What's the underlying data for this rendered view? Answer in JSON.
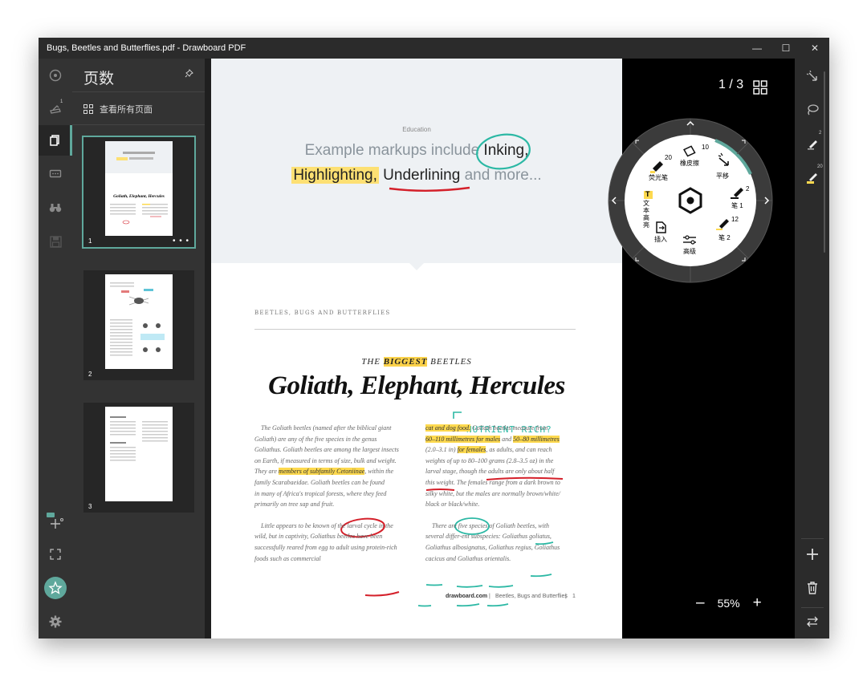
{
  "window": {
    "title": "Bugs, Beetles and Butterflies.pdf - Drawboard PDF",
    "minimize": "—",
    "maximize": "☐",
    "close": "✕"
  },
  "left_toolbar": {
    "items": [
      {
        "name": "annotations",
        "icon": "target-icon"
      },
      {
        "name": "stamp",
        "icon": "stamp-icon",
        "badge": "1"
      },
      {
        "name": "pages",
        "icon": "pages-icon",
        "active": true
      },
      {
        "name": "comments",
        "icon": "comment-icon"
      },
      {
        "name": "search",
        "icon": "binoculars-icon"
      },
      {
        "name": "save",
        "icon": "save-icon"
      }
    ],
    "bottom": [
      {
        "name": "calibrate",
        "icon": "calibrate-icon"
      },
      {
        "name": "fullscreen",
        "icon": "expand-icon"
      },
      {
        "name": "favorites",
        "icon": "star-icon"
      },
      {
        "name": "settings",
        "icon": "gear-icon"
      }
    ]
  },
  "pages_panel": {
    "title": "页数",
    "view_all": "查看所有页面",
    "thumbnails": [
      {
        "number": "1",
        "selected": true,
        "more": "• • •"
      },
      {
        "number": "2",
        "selected": false
      },
      {
        "number": "3",
        "selected": false
      }
    ]
  },
  "document": {
    "band": {
      "category": "Education",
      "line1_before": "Example markups include ",
      "line1_strong": "Inking,",
      "line2_hl": "Highlighting,",
      "line2_strong": "Underlining",
      "line2_after": " and more..."
    },
    "section_label": "BEETLES, BUGS AND BUTTERFLIES",
    "kicker_before": "THE ",
    "kicker_hl": "BIGGEST",
    "kicker_after": " BEETLES",
    "title": "Goliath, Elephant, Hercules",
    "ink_note": "NUTRIENT RICH?",
    "col1": {
      "p1": [
        "The Goliath beetles (named after the biblical giant",
        "Goliath) are any of the five species in the genus",
        "Goliathus. Goliath beetles are among the largest insects",
        "on Earth, if measured in terms of size, bulk and weight.",
        "They are ",
        "members of subfamily Cetoniinae",
        ", within the",
        "family Scarabaeidae. Goliath beetles can be found",
        "in many of Africa's tropical forests, where they feed",
        "primarily on tree sap and fruit."
      ],
      "p2": [
        "Little appears to be known of the larval cycle in the",
        "wild, but in captivity, Goliathus beetles have been",
        "successfully reared from egg to adult using protein-rich",
        "foods such as commercial"
      ]
    },
    "col2": {
      "p1": [
        "cat and dog food.",
        " Goliath beetles measure from",
        "60–110 millimetres for males",
        " and ",
        "50–80 millimetres",
        "(2.0–3.1 in) ",
        "for females",
        ", as adults, and can reach",
        "weights of up to 80–100 grams (2.8–3.5 oz) in the",
        "larval stage, though the adults are only about half",
        "this weight. The females range from a dark brown to",
        "silky white, but the males are normally brown/white/",
        "black or black/white."
      ],
      "p2": [
        "There are five species of Goliath beetles, with",
        "several differ-ent subspecies: Goliathus goliatus,",
        "Goliathus albosignatus, Goliathus regius, Goliathus",
        "cacicus and Goliathus orientalis."
      ]
    },
    "footer_site": "drawboard.com",
    "footer_sep": "|",
    "footer_title": "Beetles, Bugs and Butterflies",
    "footer_page": "1"
  },
  "viewer": {
    "page_indicator": "1 / 3",
    "zoom_minus": "–",
    "zoom_level": "55%",
    "zoom_plus": "+"
  },
  "radial_menu": {
    "highlighter": {
      "label": "荧光笔",
      "size": "20"
    },
    "eraser": {
      "label": "橡皮擦",
      "size": "10"
    },
    "pan": {
      "label": "平移"
    },
    "pen1": {
      "label": "笔 1",
      "size": "2"
    },
    "pen2": {
      "label": "笔 2",
      "size": "12"
    },
    "advanced": {
      "label": "高级"
    },
    "insert": {
      "label": "插入"
    },
    "text_hl": {
      "label": "文本高亮",
      "glyph": "T"
    },
    "accent": "#5fa89c"
  },
  "right_toolbar": {
    "items": [
      {
        "name": "pan",
        "icon": "pan-icon"
      },
      {
        "name": "lasso",
        "icon": "lasso-icon"
      },
      {
        "name": "pen",
        "icon": "pen-icon",
        "badge": "2"
      },
      {
        "name": "highlighter",
        "icon": "highlighter-icon",
        "badge": "20"
      }
    ],
    "bottom": [
      {
        "name": "add",
        "icon": "plus-icon"
      },
      {
        "name": "delete",
        "icon": "trash-icon"
      },
      {
        "name": "swap",
        "icon": "swap-icon"
      }
    ]
  },
  "colors": {
    "accent": "#5fa89c",
    "highlight": "#fdd94f",
    "ink_red": "#d4202a",
    "ink_teal": "#2bb8a4"
  }
}
